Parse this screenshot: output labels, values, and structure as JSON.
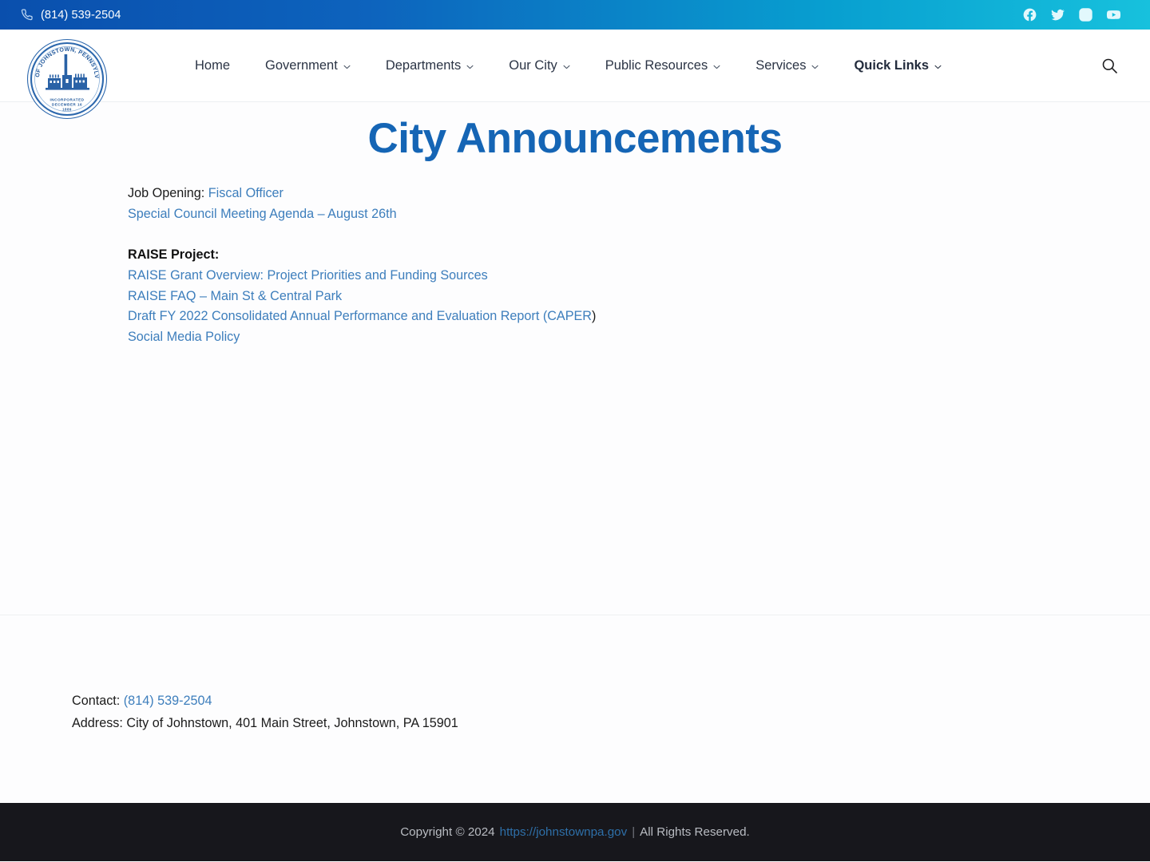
{
  "topbar": {
    "phone_icon": "phone-icon",
    "phone": "(814) 539-2504",
    "gradient_from": "#0a4fad",
    "gradient_to": "#17c1dd",
    "socials": [
      {
        "name": "facebook-icon",
        "label": "Facebook"
      },
      {
        "name": "twitter-icon",
        "label": "Twitter"
      },
      {
        "name": "instagram-icon",
        "label": "Instagram"
      },
      {
        "name": "youtube-icon",
        "label": "YouTube"
      }
    ]
  },
  "header": {
    "logo": {
      "icon": "city-seal-logo",
      "ring_text_top": "CITY OF JOHNSTOWN, PENNSYLVANIA",
      "ring_text_bottom_1": "INCORPORATED",
      "ring_text_bottom_2": "DECEMBER 16",
      "ring_text_bottom_3": "1889",
      "color": "#1f5fa8"
    },
    "nav": [
      {
        "label": "Home",
        "has_dropdown": false,
        "active": false
      },
      {
        "label": "Government",
        "has_dropdown": true,
        "active": false
      },
      {
        "label": "Departments",
        "has_dropdown": true,
        "active": false
      },
      {
        "label": "Our City",
        "has_dropdown": true,
        "active": false
      },
      {
        "label": "Public Resources",
        "has_dropdown": true,
        "active": false
      },
      {
        "label": "Services",
        "has_dropdown": true,
        "active": false
      },
      {
        "label": "Quick Links",
        "has_dropdown": true,
        "active": true
      }
    ],
    "search_icon": "search-icon"
  },
  "main": {
    "title": "City Announcements",
    "title_color": "#1565b5",
    "link_color": "#3d7ebc",
    "blocks": [
      {
        "type": "line",
        "prefix": "Job Opening:",
        "link": "Fiscal Officer",
        "suffix": ""
      },
      {
        "type": "line",
        "prefix": "",
        "link": "Special Council Meeting Agenda – August 26th",
        "suffix": ""
      },
      {
        "type": "spacer"
      },
      {
        "type": "heading",
        "text": "RAISE Project:"
      },
      {
        "type": "line",
        "prefix": "",
        "link": "RAISE Grant Overview: Project Priorities and Funding Sources",
        "suffix": ""
      },
      {
        "type": "line",
        "prefix": "",
        "link": "RAISE FAQ – Main St & Central Park",
        "suffix": ""
      },
      {
        "type": "line",
        "prefix": "",
        "link": "Draft FY 2022 Consolidated Annual Performance and Evaluation Report (CAPER",
        "suffix": ")"
      },
      {
        "type": "line",
        "prefix": "",
        "link": "Social Media Policy",
        "suffix": ""
      }
    ]
  },
  "footer": {
    "contact_label": "Contact:",
    "contact_phone": "(814) 539-2504",
    "address_label": "Address:",
    "address_value": "City of Johnstown, 401 Main Street, Johnstown, PA 15901",
    "copyright_prefix": "Copyright © 2024",
    "copyright_url": "https://johnstownpa.gov",
    "copyright_separator": "|",
    "copyright_suffix": "All Rights Reserved.",
    "background": "#17171c"
  }
}
